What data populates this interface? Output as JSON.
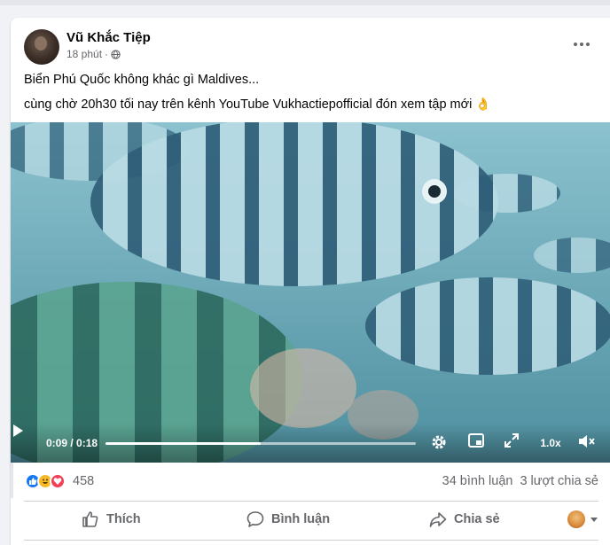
{
  "post": {
    "author": "Vũ Khắc Tiệp",
    "time": "18 phút",
    "privacy_icon": "globe-icon",
    "line1": "Biển Phú Quốc không khác gì Maldives...",
    "line2": "cùng chờ 20h30 tối nay trên kênh YouTube Vukhactiepofficial đón xem tập mới",
    "emoji": "👌"
  },
  "video": {
    "time": "0:09 / 0:18",
    "progress": 0.5,
    "speed": "1.0x",
    "icons": [
      "play-icon",
      "settings-icon",
      "miniplayer-icon",
      "fullscreen-icon",
      "volume-muted-icon"
    ]
  },
  "engagement": {
    "reaction_icons": [
      "like-reaction-icon",
      "haha-reaction-icon",
      "love-reaction-icon"
    ],
    "reaction_count": "458",
    "comments": "34 bình luận",
    "shares": "3 lượt chia sẻ"
  },
  "actions": {
    "like": "Thích",
    "comment": "Bình luận",
    "share": "Chia sẻ"
  },
  "colors": {
    "accent": "#1877f2",
    "muted_text": "#65676b"
  }
}
